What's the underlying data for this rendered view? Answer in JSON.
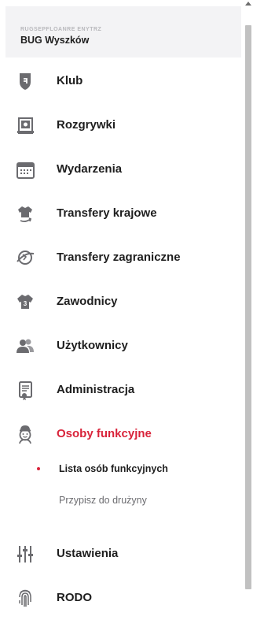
{
  "header": {
    "club_subtitle": "RUGSEPFLOANRE ENYTRZ",
    "club_name": "BUG Wyszków"
  },
  "menu": [
    {
      "id": "klub",
      "label": "Klub",
      "icon": "shield-icon"
    },
    {
      "id": "rozgrywki",
      "label": "Rozgrywki",
      "icon": "competitions-icon"
    },
    {
      "id": "wydarzenia",
      "label": "Wydarzenia",
      "icon": "calendar-icon"
    },
    {
      "id": "transfery-krajowe",
      "label": "Transfery krajowe",
      "icon": "jersey-transfer-icon"
    },
    {
      "id": "transfery-zagraniczne",
      "label": "Transfery zagraniczne",
      "icon": "globe-transfer-icon"
    },
    {
      "id": "zawodnicy",
      "label": "Zawodnicy",
      "icon": "jersey-icon"
    },
    {
      "id": "uzytkownicy",
      "label": "Użytkownicy",
      "icon": "users-icon"
    },
    {
      "id": "administracja",
      "label": "Administracja",
      "icon": "document-icon"
    },
    {
      "id": "osoby-funkcyjne",
      "label": "Osoby funkcyjne",
      "icon": "referee-icon",
      "active": true
    },
    {
      "id": "ustawienia",
      "label": "Ustawienia",
      "icon": "sliders-icon"
    },
    {
      "id": "rodo",
      "label": "RODO",
      "icon": "fingerprint-icon"
    }
  ],
  "submenu": [
    {
      "label": "Lista osób funkcyjnych",
      "current": true
    },
    {
      "label": "Przypisz do drużyny",
      "current": false
    }
  ],
  "colors": {
    "accent": "#d9233a",
    "icon_gray": "#6b6b6f",
    "header_bg": "#f3f3f5"
  }
}
